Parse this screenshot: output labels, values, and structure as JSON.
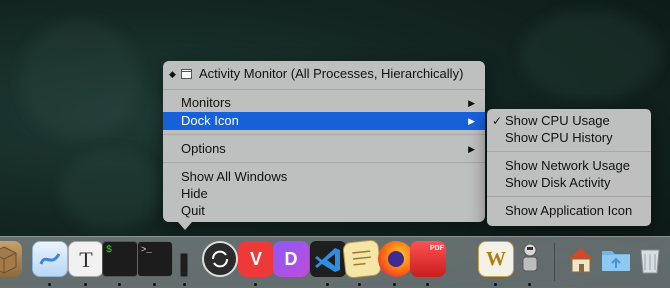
{
  "menu": {
    "title": "Activity Monitor (All Processes, Hierarchically)",
    "items": {
      "monitors": "Monitors",
      "dock_icon": "Dock Icon",
      "options": "Options",
      "show_all_windows": "Show All Windows",
      "hide": "Hide",
      "quit": "Quit"
    },
    "arrow_glyph": "▶",
    "title_marker": "◆"
  },
  "submenu": {
    "checkmark": "✓",
    "items": {
      "show_cpu_usage": "Show CPU Usage",
      "show_cpu_history": "Show CPU History",
      "show_network_usage": "Show Network Usage",
      "show_disk_activity": "Show Disk Activity",
      "show_application_icon": "Show Application Icon"
    },
    "checked_item": "Show CPU Usage"
  },
  "dock": {
    "text_edit_glyph": "T",
    "terminal_prompt_1": "$",
    "terminal_prompt_2": ">_",
    "vivaldi_glyph": "V",
    "dash_glyph": "D",
    "word_glyph": "W",
    "pdf_badge": "PDF",
    "icons": [
      "package-icon",
      "mindnode-icon",
      "textedit-icon",
      "activity-terminal-icon",
      "terminal-icon",
      "activity-monitor-dock-icon",
      "sync-icon",
      "vivaldi-icon",
      "dash-icon",
      "vscode-icon",
      "script-editor-icon",
      "firefox-icon",
      "pdf-app-icon",
      "word-icon",
      "automator-icon",
      "home-folder-icon",
      "folder-icon",
      "trash-icon"
    ]
  },
  "colors": {
    "selection": "#1761d8",
    "menu_bg": "#c4c4c4"
  }
}
